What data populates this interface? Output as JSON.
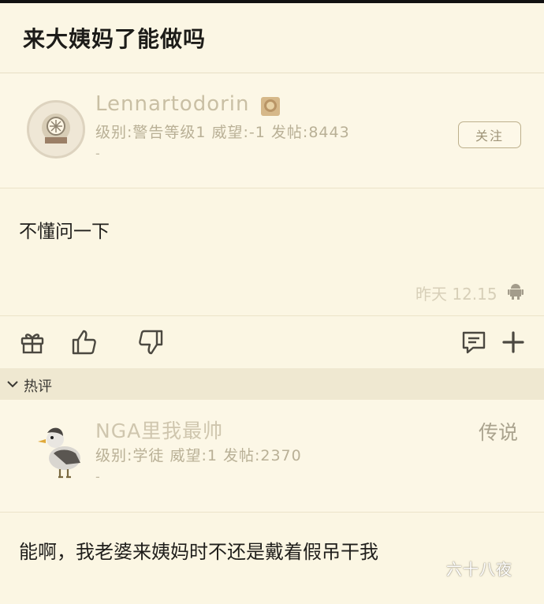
{
  "page": {
    "title": "来大姨妈了能做吗"
  },
  "post": {
    "author": {
      "username": "Lennartodorin",
      "meta": "级别:警告等级1 威望:-1 发帖:8443",
      "signature": "-"
    },
    "follow_label": "关注",
    "content": "不懂问一下",
    "time": "昨天 12.15",
    "device_icon": "android-icon"
  },
  "actions": {
    "icons": [
      "gift-icon",
      "thumbs-up-icon",
      "thumbs-down-icon",
      "comment-icon",
      "plus-icon"
    ]
  },
  "hot_section": {
    "label": "热评"
  },
  "reply": {
    "username": "NGA里我最帅",
    "meta": "级别:学徒 威望:1 发帖:2370",
    "signature": "-",
    "rank": "传说",
    "content": "能啊，我老婆来姨妈时不还是戴着假吊干我"
  },
  "watermark": "六十八夜",
  "colors": {
    "background": "#fbf6e3",
    "muted_text": "#b9b096",
    "section_header": "#efe8d1"
  }
}
